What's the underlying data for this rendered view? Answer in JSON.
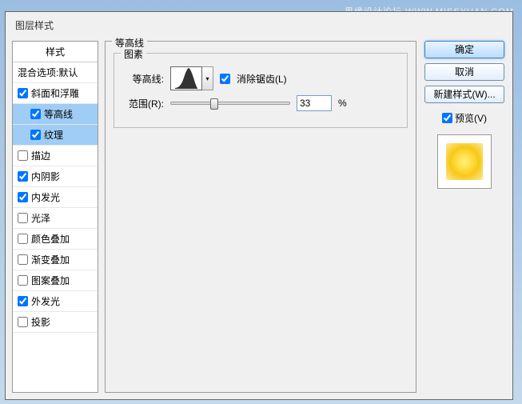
{
  "watermark": "思缘设计论坛  WWW.MISSYUAN.COM",
  "dialog_title": "图层样式",
  "styles": {
    "header": "样式",
    "items": [
      {
        "label": "混合选项:默认",
        "checked": null
      },
      {
        "label": "斜面和浮雕",
        "checked": true
      },
      {
        "label": "等高线",
        "checked": true,
        "sub": true,
        "selected": true
      },
      {
        "label": "纹理",
        "checked": true,
        "sub": true,
        "selected": true
      },
      {
        "label": "描边",
        "checked": false
      },
      {
        "label": "内阴影",
        "checked": true
      },
      {
        "label": "内发光",
        "checked": true
      },
      {
        "label": "光泽",
        "checked": false
      },
      {
        "label": "颜色叠加",
        "checked": false
      },
      {
        "label": "渐变叠加",
        "checked": false
      },
      {
        "label": "图案叠加",
        "checked": false
      },
      {
        "label": "外发光",
        "checked": true
      },
      {
        "label": "投影",
        "checked": false
      }
    ]
  },
  "settings": {
    "panel_title": "等高线",
    "group_title": "图素",
    "contour_label": "等高线:",
    "antialias_label": "消除锯齿(L)",
    "antialias_checked": true,
    "range_label": "范围(R):",
    "range_value": "33",
    "range_unit": "%"
  },
  "buttons": {
    "ok": "确定",
    "cancel": "取消",
    "new_style": "新建样式(W)...",
    "preview_label": "预览(V)",
    "preview_checked": true
  }
}
